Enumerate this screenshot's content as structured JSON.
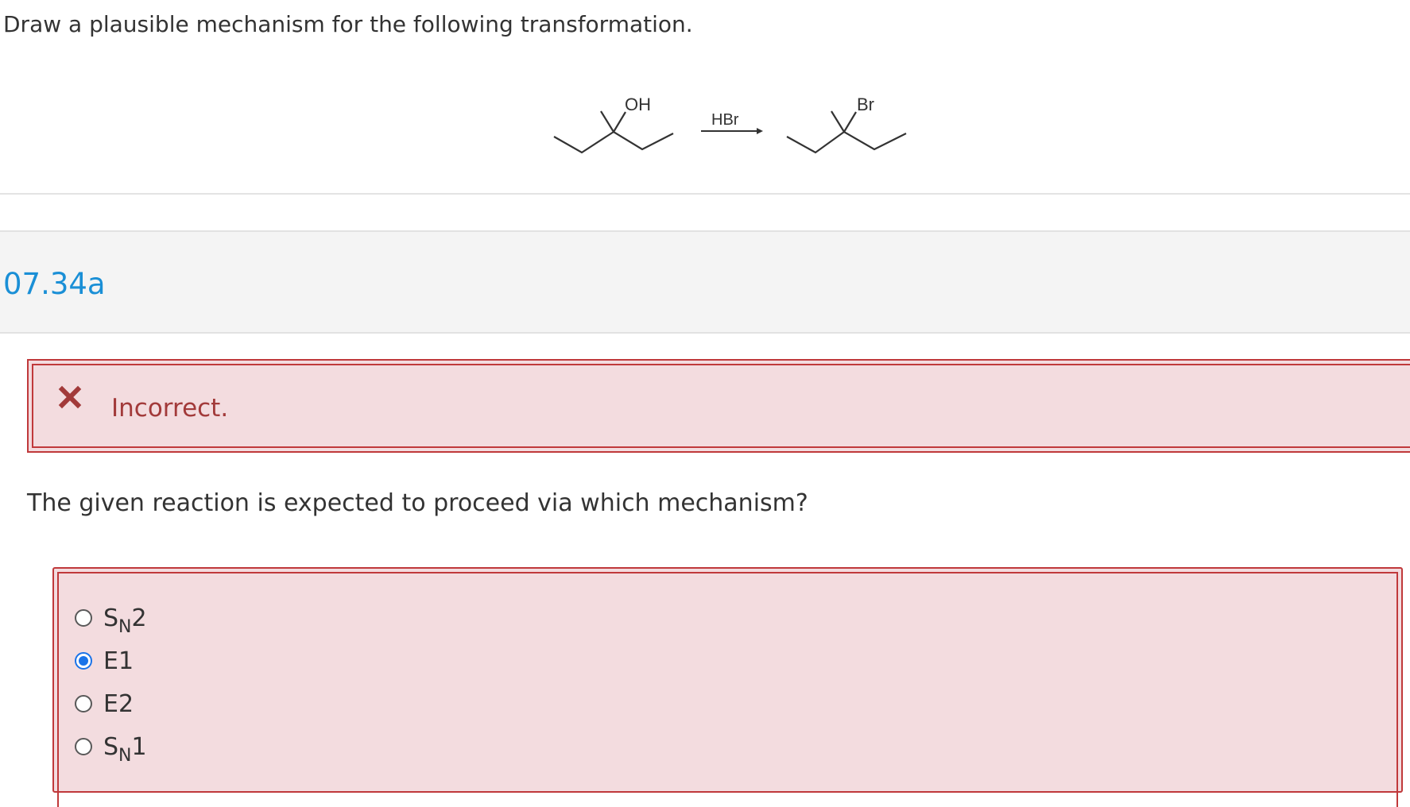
{
  "prompt": "Draw a plausible mechanism for the following transformation.",
  "reaction": {
    "reactant_label": "OH",
    "reagent": "HBr",
    "product_label": "Br"
  },
  "question_id": "07.34a",
  "feedback": {
    "icon": "x-mark-icon",
    "text": "Incorrect."
  },
  "question": "The given reaction is expected to proceed via which mechanism?",
  "options": [
    {
      "main": "S",
      "sub": "N",
      "suffix": "2",
      "selected": false
    },
    {
      "main": "E1",
      "sub": "",
      "suffix": "",
      "selected": true
    },
    {
      "main": "E2",
      "sub": "",
      "suffix": "",
      "selected": false
    },
    {
      "main": "S",
      "sub": "N",
      "suffix": "1",
      "selected": false
    }
  ],
  "colors": {
    "link_blue": "#1a8fd6",
    "error_red": "#c0393b",
    "error_bg": "#f3dcdf",
    "radio_selected": "#1a73e8"
  }
}
